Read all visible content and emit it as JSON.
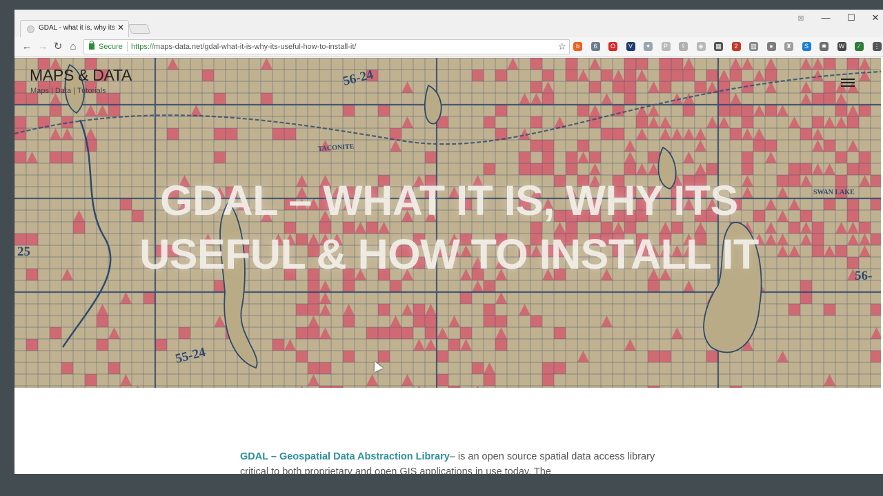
{
  "browser": {
    "tab_title": "GDAL - what it is, why its",
    "tab_close": "✕",
    "window_controls": {
      "minimize": "—",
      "maximize": "☐",
      "close": "✕",
      "badge": "⊠"
    },
    "nav": {
      "back": "←",
      "forward": "→",
      "reload": "↻",
      "home": "⌂"
    },
    "secure_label": "Secure",
    "url_scheme": "https://",
    "url_rest": "maps-data.net/gdal-what-it-is-why-its-useful-how-to-install-it/",
    "bookmark_star": "☆",
    "extensions": [
      {
        "name": "bitly-icon",
        "glyph": "b",
        "color": "#ee6123"
      },
      {
        "name": "extension-icon",
        "glyph": "6",
        "color": "#6b7d8c"
      },
      {
        "name": "opera-icon",
        "glyph": "O",
        "color": "#d52a2a"
      },
      {
        "name": "vuejs-icon",
        "glyph": "V",
        "color": "#1e3c6e"
      },
      {
        "name": "dropbox-icon",
        "glyph": "✦",
        "color": "#9aa5b0"
      },
      {
        "name": "pinterest-icon",
        "glyph": "P",
        "color": "#b9b9b9"
      },
      {
        "name": "upload-icon",
        "glyph": "⇪",
        "color": "#b0b0b0"
      },
      {
        "name": "shield-icon",
        "glyph": "◈",
        "color": "#b8b8b8"
      },
      {
        "name": "grid-icon",
        "glyph": "▦",
        "color": "#555555"
      },
      {
        "name": "mail-icon",
        "glyph": "2",
        "color": "#c0392b"
      },
      {
        "name": "columns-icon",
        "glyph": "▥",
        "color": "#8a8a8a"
      },
      {
        "name": "circle-icon",
        "glyph": "●",
        "color": "#7d7d7d"
      },
      {
        "name": "ghost-icon",
        "glyph": "♜",
        "color": "#9d9d9d"
      },
      {
        "name": "skype-icon",
        "glyph": "S",
        "color": "#1a7fd4"
      },
      {
        "name": "bug-icon",
        "glyph": "✱",
        "color": "#6d6d6d"
      },
      {
        "name": "wordpress-icon",
        "glyph": "W",
        "color": "#464646"
      },
      {
        "name": "feather-icon",
        "glyph": "∕",
        "color": "#2f7d3a"
      },
      {
        "name": "menu-dots-icon",
        "glyph": "⋮",
        "color": "#555555"
      }
    ]
  },
  "site": {
    "title": "MAPS & DATA",
    "tagline": "Maps | Data | Tutorials"
  },
  "hero": {
    "title_line1": "GDAL – WHAT IT IS, WHY ITS",
    "title_line2": "USEFUL & HOW TO INSTALL IT",
    "map_labels": {
      "top": "56-24",
      "bottom": "55-24",
      "left": "25",
      "right": "56-",
      "town": "TACONITE",
      "lake": "SWAN LAKE"
    }
  },
  "article": {
    "lead": "GDAL – Geospatial Data Abstraction Library",
    "text": "– is an open source spatial data access library critical to both proprietary and open GIS applications in use today. The"
  },
  "colors": {
    "hero_pink": "#d4576c",
    "map_line": "#2c4a6e",
    "map_bg": "#c0b190",
    "lead_text": "#2e8f9c"
  }
}
